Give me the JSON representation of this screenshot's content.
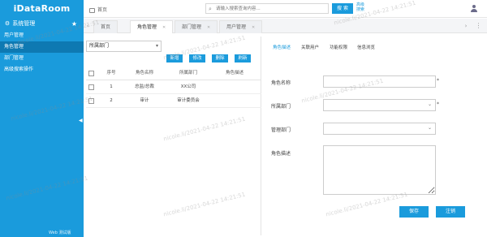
{
  "app": {
    "brand": "iDataRoom"
  },
  "sidebar": {
    "section_title": "系统管理",
    "items": [
      {
        "label": "用户管理",
        "active": false
      },
      {
        "label": "角色管理",
        "active": true
      },
      {
        "label": "部门管理",
        "active": false
      },
      {
        "label": "高级搜索操作",
        "active": false
      }
    ],
    "bottom_text": "Web 测试版",
    "collapse_glyph": "◀"
  },
  "header": {
    "breadcrumb": "首页",
    "search": {
      "placeholder": "请输入搜索查询内容...",
      "button_label": "搜 索",
      "advanced_label": "高级搜索"
    }
  },
  "tabs": [
    {
      "label": "首页",
      "active": false,
      "closable": false
    },
    {
      "label": "角色管理",
      "active": true,
      "closable": true
    },
    {
      "label": "部门管理",
      "active": false,
      "closable": true
    },
    {
      "label": "用户管理",
      "active": false,
      "closable": true
    }
  ],
  "left": {
    "dept_select": "所属部门",
    "buttons": [
      "新增",
      "修改",
      "删除",
      "刷新"
    ],
    "grid": {
      "columns": [
        "序号",
        "角色名称",
        "所属部门",
        "角色描述"
      ],
      "rows": [
        [
          "1",
          "总监/总裁",
          "XX公司",
          ""
        ],
        [
          "2",
          "审计",
          "审计委员会",
          ""
        ]
      ]
    }
  },
  "right": {
    "sub_tabs": [
      {
        "label": "角色描述",
        "active": true
      },
      {
        "label": "关联用户",
        "active": false
      },
      {
        "label": "功能权限",
        "active": false
      },
      {
        "label": "信息浏览",
        "active": false
      }
    ],
    "form": {
      "name_label": "角色名称",
      "dept_label": "所属部门",
      "mgmt_label": "管理部门",
      "desc_label": "角色描述",
      "required_mark": "*"
    },
    "buttons": {
      "save": "保存",
      "cancel": "注销"
    }
  },
  "watermark": "nicole.li/2021-04-22 14:21:51"
}
